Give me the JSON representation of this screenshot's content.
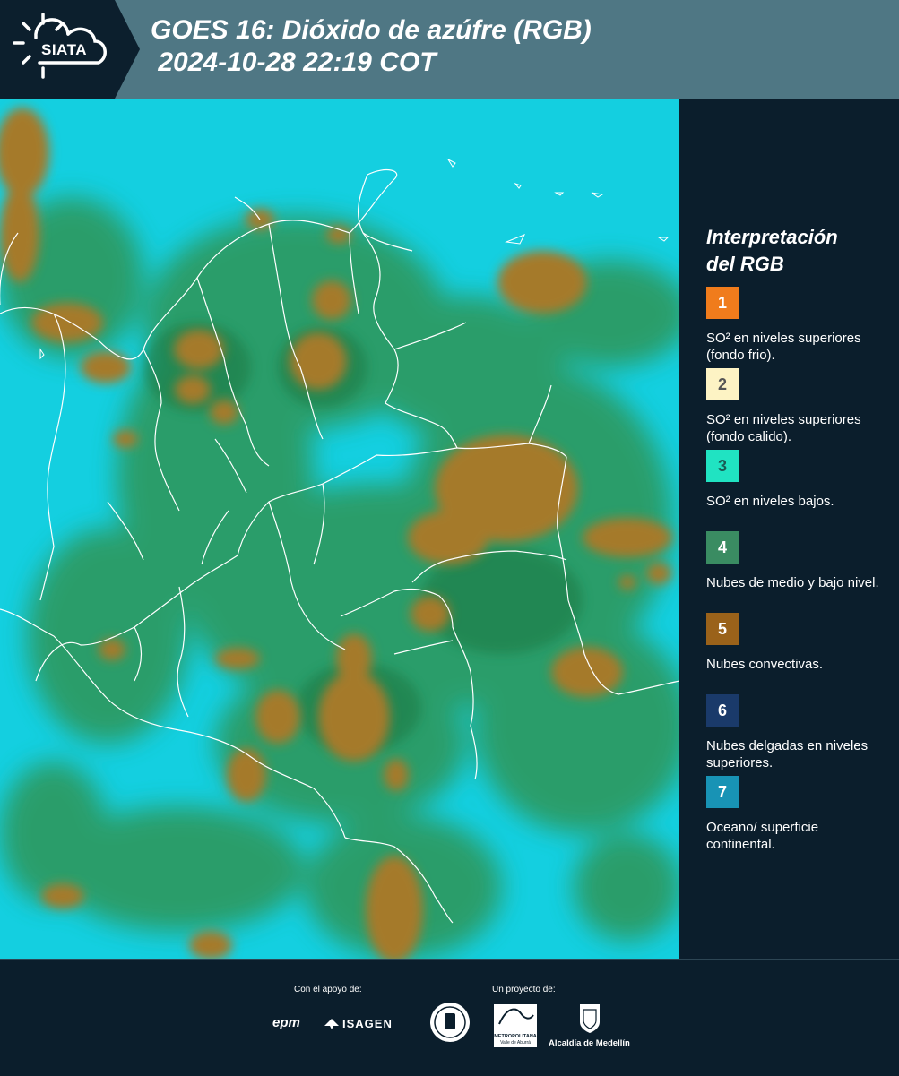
{
  "header": {
    "logo_text": "SIATA",
    "title": "GOES 16: Dióxido de azúfre (RGB)\n 2024-10-28 22:19 COT"
  },
  "map": {
    "product": "sulfur-dioxide-rgb",
    "colors": {
      "ocean": "#12d2e0",
      "clouds_low": "#2e9a55",
      "convective": "#a57a2a",
      "border": "#ffffff"
    }
  },
  "legend": {
    "title_line1": "Interpretación",
    "title_line2": "del RGB",
    "items": [
      {
        "num": "1",
        "label": "SO² en niveles superiores (fondo frio).",
        "color": "#f07c1c",
        "text_color": "#ffffff"
      },
      {
        "num": "2",
        "label": "SO² en niveles superiores (fondo calido).",
        "color": "#fdf3c4",
        "text_color": "#555555"
      },
      {
        "num": "3",
        "label": "SO² en niveles bajos.",
        "color": "#20e3c2",
        "text_color": "#1a5a55"
      },
      {
        "num": "4",
        "label": "Nubes de medio y bajo nivel.",
        "color": "#3a8c62",
        "text_color": "#ffffff"
      },
      {
        "num": "5",
        "label": "Nubes convectivas.",
        "color": "#9a621a",
        "text_color": "#ffffff"
      },
      {
        "num": "6",
        "label": "Nubes delgadas en niveles superiores.",
        "color": "#1a3a6a",
        "text_color": "#ffffff"
      },
      {
        "num": "7",
        "label": "Oceano/ superficie continental.",
        "color": "#1893b5",
        "text_color": "#ffffff"
      }
    ]
  },
  "footer": {
    "support_label": "Con el apoyo de:",
    "project_label": "Un proyecto de:",
    "sponsor1": "epm",
    "sponsor2": "ISAGEN",
    "area_line1": "METROPOLITANA",
    "area_line2": "Valle de Aburrá",
    "alcaldia": "Alcaldía de Medellín"
  }
}
